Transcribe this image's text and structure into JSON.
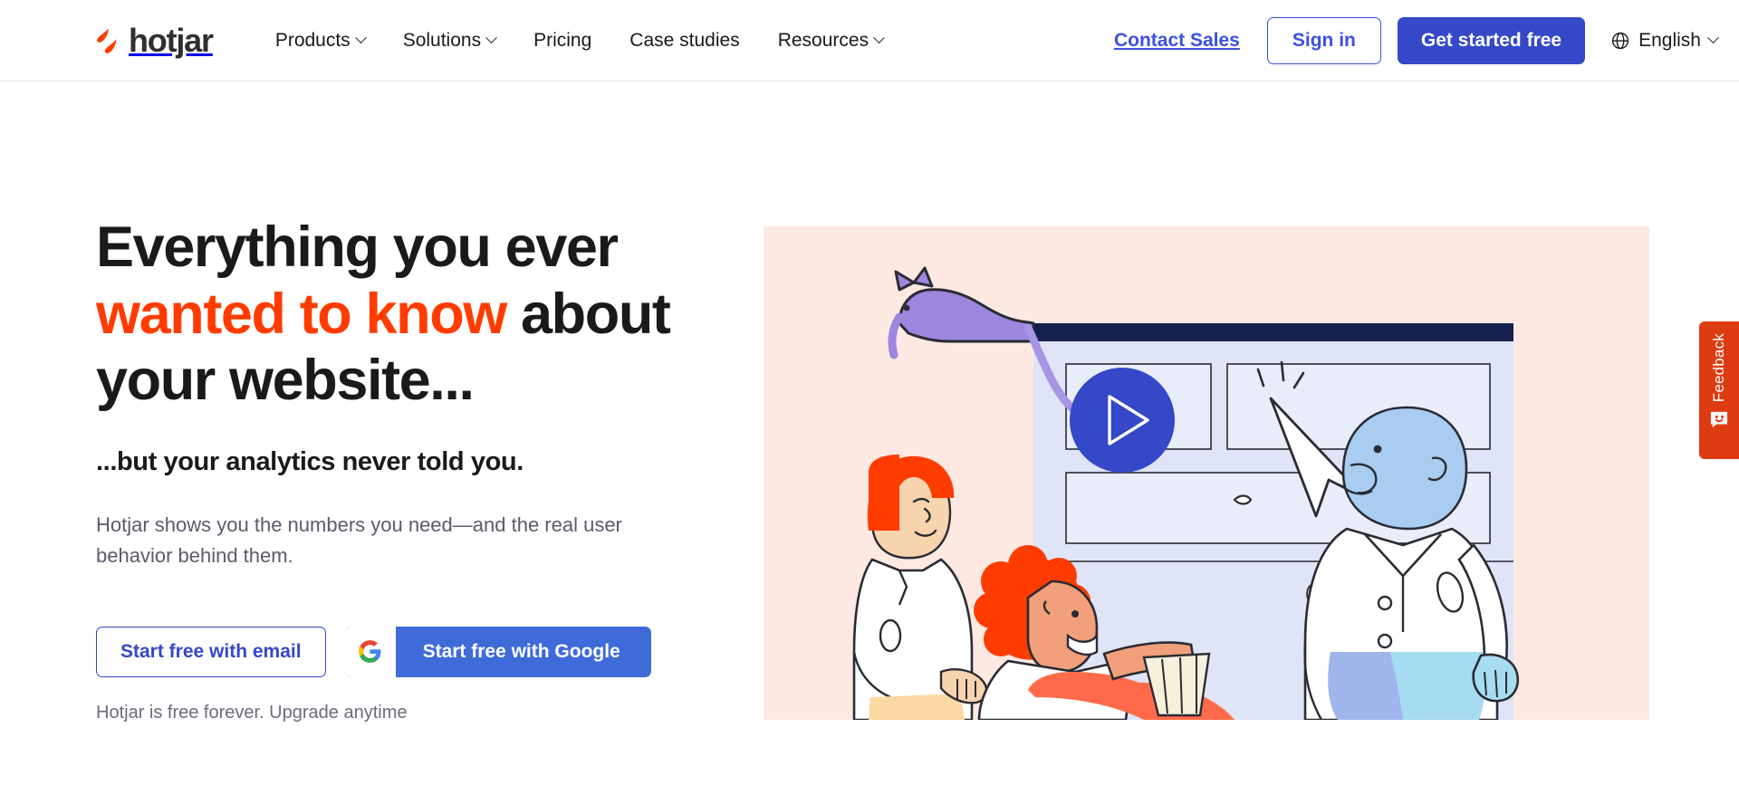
{
  "brand": {
    "name": "hotjar",
    "logo_icon": "hotjar-flame-mark",
    "accent_orange": "#ff3c00",
    "accent_blue": "#3448c8",
    "link_blue": "#3c50e0",
    "illustration_bg": "#fde9e2",
    "feedback_red": "#dd3c12"
  },
  "header": {
    "nav": [
      {
        "label": "Products",
        "has_dropdown": true,
        "icon": "chevron-down-icon"
      },
      {
        "label": "Solutions",
        "has_dropdown": true,
        "icon": "chevron-down-icon"
      },
      {
        "label": "Pricing",
        "has_dropdown": false,
        "icon": ""
      },
      {
        "label": "Case studies",
        "has_dropdown": false,
        "icon": ""
      },
      {
        "label": "Resources",
        "has_dropdown": true,
        "icon": "chevron-down-icon"
      }
    ],
    "contact_sales": "Contact Sales",
    "sign_in": "Sign in",
    "get_started": "Get started free",
    "language": {
      "label": "English",
      "globe_icon": "globe-icon",
      "chevron_icon": "chevron-down-icon"
    }
  },
  "hero": {
    "headline_line1": "Everything you ever",
    "headline_accent": "wanted to know",
    "headline_line2_tail": " about",
    "headline_line3": "your website...",
    "subheadline": "...but your analytics never told you.",
    "body": "Hotjar shows you the numbers you need—and the real user behavior behind them.",
    "cta_email": "Start free with email",
    "cta_google": "Start free with Google",
    "google_icon": "google-g-icon",
    "fineprint": "Hotjar is free forever. Upgrade anytime",
    "illustration": {
      "name": "hero-illustration-people-browser-cat",
      "play_button_icon": "play-triangle-icon",
      "elements": [
        "purple-cat",
        "browser-window",
        "woman-red-bob-hair",
        "man-curly-red-hair",
        "man-blue-bald",
        "cursor-arrow",
        "play-button"
      ]
    }
  },
  "feedback_widget": {
    "label": "Feedback",
    "icon": "smiley-chat-bubble-icon"
  }
}
